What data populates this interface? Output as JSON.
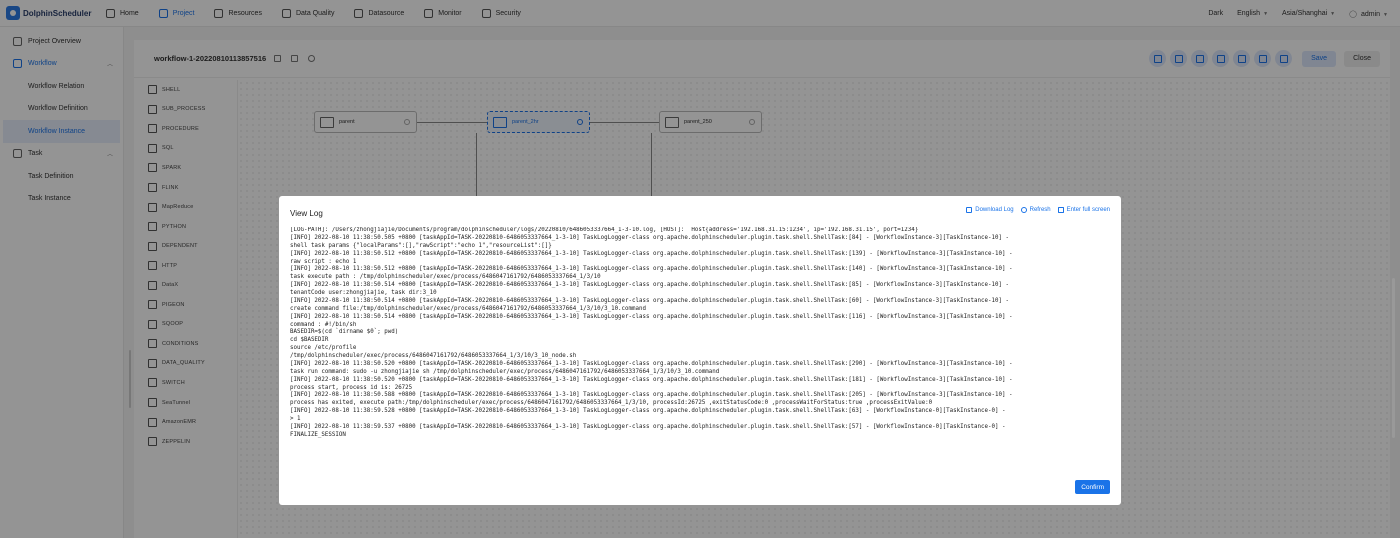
{
  "app": {
    "name": "DolphinScheduler"
  },
  "nav": [
    {
      "label": "Home",
      "icon": "home-icon"
    },
    {
      "label": "Project",
      "icon": "project-icon",
      "active": true
    },
    {
      "label": "Resources",
      "icon": "folder-icon"
    },
    {
      "label": "Data Quality",
      "icon": "data-quality-icon"
    },
    {
      "label": "Datasource",
      "icon": "database-icon"
    },
    {
      "label": "Monitor",
      "icon": "monitor-icon"
    },
    {
      "label": "Security",
      "icon": "security-icon"
    }
  ],
  "top_right": {
    "theme": "Dark",
    "language": "English",
    "timezone": "Asia/Shanghai",
    "user": "admin"
  },
  "sidebar": {
    "project_overview": "Project Overview",
    "workflow": "Workflow",
    "workflow_relation": "Workflow Relation",
    "workflow_definition": "Workflow Definition",
    "workflow_instance": "Workflow Instance",
    "task": "Task",
    "task_definition": "Task Definition",
    "task_instance": "Task Instance"
  },
  "toolbar": {
    "title": "workflow-1-20220810113857516",
    "save_label": "Save",
    "close_label": "Close"
  },
  "palette": [
    "SHELL",
    "SUB_PROCESS",
    "PROCEDURE",
    "SQL",
    "SPARK",
    "FLINK",
    "MapReduce",
    "PYTHON",
    "DEPENDENT",
    "HTTP",
    "DataX",
    "PIGEON",
    "SQOOP",
    "CONDITIONS",
    "DATA_QUALITY",
    "SWITCH",
    "SeaTunnel",
    "AmazonEMR",
    "ZEPPELIN"
  ],
  "nodes": [
    {
      "label": "parent"
    },
    {
      "label": "parent_2hr"
    },
    {
      "label": "parent_250"
    }
  ],
  "modal": {
    "title": "View Log",
    "download_label": "Download Log",
    "refresh_label": "Refresh",
    "fullscreen_label": "Enter full screen",
    "confirm_label": "Confirm",
    "log_lines": [
      "[LOG-PATH]: /Users/zhongjiajie/Documents/program/dolphinscheduler/logs/20220810/6486053337664_1-3-10.log, [HOST]:  Host{address='192.168.31.15:1234', ip='192.168.31.15', port=1234}",
      "[INFO] 2022-08-10 11:38:50.505 +0800 [taskAppId=TASK-20220810-6486053337664_1-3-10] TaskLogLogger-class org.apache.dolphinscheduler.plugin.task.shell.ShellTask:[84] - [WorkflowInstance-3][TaskInstance-10] -",
      "shell task params {\"localParams\":[],\"rawScript\":\"echo 1\",\"resourceList\":[]}",
      "[INFO] 2022-08-10 11:38:50.512 +0800 [taskAppId=TASK-20220810-6486053337664_1-3-10] TaskLogLogger-class org.apache.dolphinscheduler.plugin.task.shell.ShellTask:[139] - [WorkflowInstance-3][TaskInstance-10] -",
      "raw script : echo 1",
      "[INFO] 2022-08-10 11:38:50.512 +0800 [taskAppId=TASK-20220810-6486053337664_1-3-10] TaskLogLogger-class org.apache.dolphinscheduler.plugin.task.shell.ShellTask:[140] - [WorkflowInstance-3][TaskInstance-10] -",
      "task execute path : /tmp/dolphinscheduler/exec/process/6486047161792/6486053337664_1/3/10",
      "[INFO] 2022-08-10 11:38:50.514 +0800 [taskAppId=TASK-20220810-6486053337664_1-3-10] TaskLogLogger-class org.apache.dolphinscheduler.plugin.task.shell.ShellTask:[85] - [WorkflowInstance-3][TaskInstance-10] -",
      "tenantCode user:zhongjiajie, task dir:3_10",
      "[INFO] 2022-08-10 11:38:50.514 +0800 [taskAppId=TASK-20220810-6486053337664_1-3-10] TaskLogLogger-class org.apache.dolphinscheduler.plugin.task.shell.ShellTask:[60] - [WorkflowInstance-3][TaskInstance-10] -",
      "create command file:/tmp/dolphinscheduler/exec/process/6486047161792/6486053337664_1/3/10/3_10.command",
      "[INFO] 2022-08-10 11:38:50.514 +0800 [taskAppId=TASK-20220810-6486053337664_1-3-10] TaskLogLogger-class org.apache.dolphinscheduler.plugin.task.shell.ShellTask:[116] - [WorkflowInstance-3][TaskInstance-10] -",
      "command : #!/bin/sh",
      "BASEDIR=$(cd `dirname $0`; pwd)",
      "cd $BASEDIR",
      "source /etc/profile",
      "/tmp/dolphinscheduler/exec/process/6486047161792/6486053337664_1/3/10/3_10_node.sh",
      "[INFO] 2022-08-10 11:38:50.520 +0800 [taskAppId=TASK-20220810-6486053337664_1-3-10] TaskLogLogger-class org.apache.dolphinscheduler.plugin.task.shell.ShellTask:[290] - [WorkflowInstance-3][TaskInstance-10] -",
      "task run command: sudo -u zhongjiajie sh /tmp/dolphinscheduler/exec/process/6486047161792/6486053337664_1/3/10/3_10.command",
      "[INFO] 2022-08-10 11:38:50.520 +0800 [taskAppId=TASK-20220810-6486053337664_1-3-10] TaskLogLogger-class org.apache.dolphinscheduler.plugin.task.shell.ShellTask:[181] - [WorkflowInstance-3][TaskInstance-10] -",
      "process start, process id is: 26725",
      "[INFO] 2022-08-10 11:38:50.588 +0800 [taskAppId=TASK-20220810-6486053337664_1-3-10] TaskLogLogger-class org.apache.dolphinscheduler.plugin.task.shell.ShellTask:[205] - [WorkflowInstance-3][TaskInstance-10] -",
      "process has exited, execute path:/tmp/dolphinscheduler/exec/process/6486047161792/6486053337664_1/3/10, processId:26725 ,exitStatusCode:0 ,processWaitForStatus:true ,processExitValue:0",
      "[INFO] 2022-08-10 11:38:59.528 +0800 [taskAppId=TASK-20220810-6486053337664_1-3-10] TaskLogLogger-class org.apache.dolphinscheduler.plugin.task.shell.ShellTask:[63] - [WorkflowInstance-0][TaskInstance-0] -",
      "> 1",
      "[INFO] 2022-08-10 11:38:59.537 +0800 [taskAppId=TASK-20220810-6486053337664_1-3-10] TaskLogLogger-class org.apache.dolphinscheduler.plugin.task.shell.ShellTask:[57] - [WorkflowInstance-0][TaskInstance-0] -",
      "FINALIZE_SESSION"
    ]
  }
}
